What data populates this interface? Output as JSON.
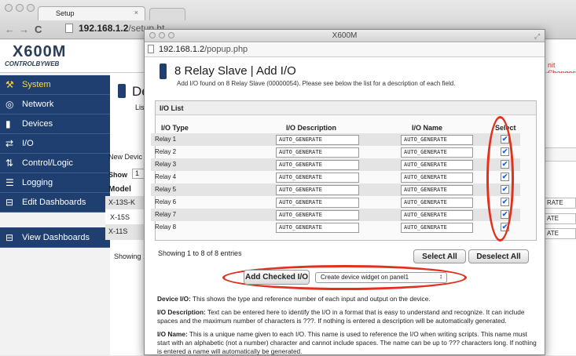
{
  "browser": {
    "tab_title": "Setup",
    "tab_close": "×",
    "nav_back": "←",
    "nav_forward": "→",
    "nav_reload": "C",
    "url_host": "192.168.1.2",
    "url_path": "/setup.ht"
  },
  "header": {
    "logo_main": "X600M",
    "logo_sub": "CONTROLBYWEB",
    "commit_text": "nit Changes"
  },
  "sidebar": {
    "items": [
      {
        "label": "System",
        "icon": "wrench-icon"
      },
      {
        "label": "Network",
        "icon": "globe-icon"
      },
      {
        "label": "Devices",
        "icon": "device-icon"
      },
      {
        "label": "I/O",
        "icon": "arrows-icon"
      },
      {
        "label": "Control/Logic",
        "icon": "logic-icon"
      },
      {
        "label": "Logging",
        "icon": "log-icon"
      },
      {
        "label": "Edit Dashboards",
        "icon": "dashboard-icon"
      },
      {
        "label": "View Dashboards",
        "icon": "dashboard-icon"
      }
    ]
  },
  "page": {
    "title_partial": "De",
    "list_partial": "Lis",
    "new_device": "New Devic",
    "show_label": "Show",
    "show_value": "1",
    "model_header": "Model",
    "models": [
      "X-13S-K",
      "X-15S",
      "X-11S"
    ],
    "right_cells": [
      "RATE",
      "ATE",
      "ATE"
    ],
    "showing_partial": "Showing 1"
  },
  "popup": {
    "window_title": "X600M",
    "url_host": "192.168.1.2",
    "url_path": "/popup.php",
    "title": "8 Relay Slave | Add I/O",
    "subtitle": "Add I/O found on 8 Relay Slave (00000054). Please see below the list for a description of each field.",
    "io_list_title": "I/O List",
    "columns": {
      "type": "I/O Type",
      "description": "I/O Description",
      "name": "I/O Name",
      "select": "Select"
    },
    "rows": [
      {
        "type": "Relay 1",
        "description": "AUTO_GENERATE",
        "name": "AUTO_GENERATE",
        "checked": "✔"
      },
      {
        "type": "Relay 2",
        "description": "AUTO_GENERATE",
        "name": "AUTO_GENERATE",
        "checked": "✔"
      },
      {
        "type": "Relay 3",
        "description": "AUTO_GENERATE",
        "name": "AUTO_GENERATE",
        "checked": "✔"
      },
      {
        "type": "Relay 4",
        "description": "AUTO_GENERATE",
        "name": "AUTO_GENERATE",
        "checked": "✔"
      },
      {
        "type": "Relay 5",
        "description": "AUTO_GENERATE",
        "name": "AUTO_GENERATE",
        "checked": "✔"
      },
      {
        "type": "Relay 6",
        "description": "AUTO_GENERATE",
        "name": "AUTO_GENERATE",
        "checked": "✔"
      },
      {
        "type": "Relay 7",
        "description": "AUTO_GENERATE",
        "name": "AUTO_GENERATE",
        "checked": "✔"
      },
      {
        "type": "Relay 8",
        "description": "AUTO_GENERATE",
        "name": "AUTO_GENERATE",
        "checked": "✔"
      }
    ],
    "showing": "Showing 1 to 8 of 8 entries",
    "select_all": "Select All",
    "deselect_all": "Deselect All",
    "add_checked": "Add Checked I/O",
    "widget_option": "Create device widget on panel1",
    "help": [
      {
        "term": "Device I/O:",
        "text": " This shows the type and reference number of each input and output on the device."
      },
      {
        "term": "I/O Description:",
        "text": " Text can be entered here to identify the I/O in a format that is easy to understand and recognize. It can include spaces and the maximum number of characters is ???. If nothing is entered a description will be automatically generated."
      },
      {
        "term": "I/O Name:",
        "text": " This is a unique name given to each I/O. This name is used to reference the I/O when writing scripts. This name must start with an alphabetic (not a number) character and cannot include spaces. The name can be up to ??? characters long. If nothing is entered a name will automatically be generated."
      }
    ]
  },
  "colors": {
    "sidebar_bg": "#1e3f70",
    "highlight": "#e2301c",
    "selected_text": "#ffd84a"
  }
}
